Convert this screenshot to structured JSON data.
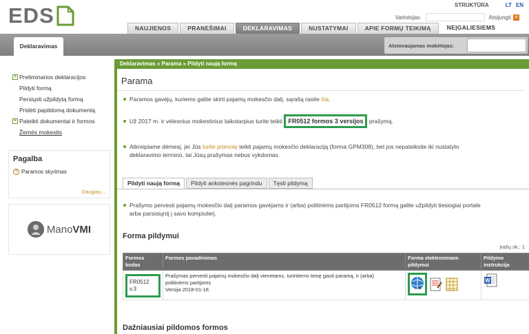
{
  "header": {
    "logo": "EDS",
    "structure_label": "STRUKTŪRA",
    "lang_lt": "LT",
    "lang_en": "EN",
    "user_label": "Vartotojas:",
    "logout_label": "Atsijungti"
  },
  "nav": {
    "tabs": [
      {
        "label": "NAUJIENOS"
      },
      {
        "label": "PRANEŠIMAI"
      },
      {
        "label": "DEKLARAVIMAS"
      },
      {
        "label": "NUSTATYMAI"
      },
      {
        "label": "APIE FORMŲ TEIKIMĄ"
      },
      {
        "label": "NEĮGALIESIEMS"
      }
    ],
    "active_tab": "DEKLARAVIMAS"
  },
  "subbar": {
    "section_tab": "Deklaravimas",
    "payer_label": "Atstovaujamas mokėtojas:"
  },
  "sidebar": {
    "items": [
      {
        "label": "Preliminarios deklaracijos"
      },
      {
        "label": "Pildyti formą"
      },
      {
        "label": "Persiųsti užpildytą formą"
      },
      {
        "label": "Pridėti papildomą dokumentą"
      },
      {
        "label": "Pateikti dokumentai ir formos"
      },
      {
        "label": "Žemės mokestis"
      }
    ],
    "help_title": "Pagalba",
    "help_item": "Paramos skyrimas",
    "help_more": "Daugiau...",
    "mano_prefix": "Mano",
    "mano_suffix": "VMI"
  },
  "main": {
    "breadcrumb": "Deklaravimas » Parama » Pildyti naują formą",
    "title": "Parama",
    "bullet1_a": "Paramos gavėjų, kuriems galite skirti pajamų mokesčio dalį, sąrašą rasite ",
    "bullet1_link": "čia",
    "bullet1_b": ".",
    "bullet2_a": "Už 2017 m. ir vėlesnius mokestinius laikotarpius turite teikti ",
    "bullet2_box": "FR0512 formos 3 versijos",
    "bullet2_b": " prašymą.",
    "bullet3_a": "Atkreipiame dėmesį, jei Jūs ",
    "bullet3_link": "turite prievolę",
    "bullet3_b": " teikti pajamų mokesčio deklaraciją (forma GPM308), bet jos nepateiksite iki nustatyto",
    "bullet3_c": "deklaravimo termino, tai Jūsų prašymas nebus vykdomas.",
    "subtabs": [
      {
        "label": "Pildyti naują formą"
      },
      {
        "label": "Pildyti ankstesnės pagrindu"
      },
      {
        "label": "Tęsti pildymą"
      }
    ],
    "info_a": "Prašymo pervesti pajamų mokesčio dalį paramos gavėjams ir (arba) politinėms partijoms FR0512 formą galite užpildyti tiesiogiai portale",
    "info_b": "arba parsisiųntį į savo kompiuterį.",
    "forma_title": "Forma pildymui",
    "records": "Įrašų sk.: 1",
    "table": {
      "col_code": "Formos kodas",
      "col_name": "Formos pavadinimas",
      "col_electronic": "Forma elektroniniam pildymui",
      "col_instruction": "Pildymo instrukcija",
      "rows": [
        {
          "code": "FR0512 v.3",
          "name_line1": "Prašymas pervesti pajamų mokesčio dalį vienetams, turintiems teisę gauti paramą, ir (arba)",
          "name_line2": "politinėms partijoms",
          "version": "Versija 2018-01-18"
        }
      ]
    },
    "frequent_title": "Dažniausiai pildomos formos"
  },
  "colors": {
    "accent_green": "#6a9b34",
    "highlight_green": "#2e9b4e",
    "link_orange": "#c88b1a",
    "header_grey": "#8a8a8a"
  }
}
